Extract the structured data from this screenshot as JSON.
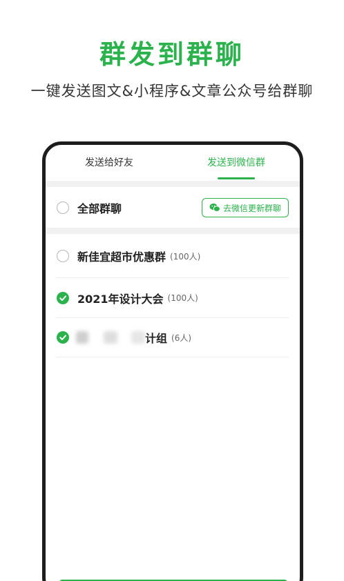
{
  "headline": "群发到群聊",
  "subline": "一键发送图文&小程序&文章公众号给群聊",
  "tabs": [
    {
      "label": "发送给好友",
      "active": false
    },
    {
      "label": "发送到微信群",
      "active": true
    }
  ],
  "select_all": {
    "label": "全部群聊",
    "checked": false
  },
  "update_button": {
    "label": "去微信更新群聊",
    "icon": "wechat-icon"
  },
  "groups": [
    {
      "name": "新佳宜超市优惠群",
      "count": "(100人)",
      "checked": false
    },
    {
      "name": "2021年设计大会",
      "count": "(100人)",
      "checked": true
    },
    {
      "name": "计组",
      "count": "(6人)",
      "checked": true
    }
  ],
  "colors": {
    "accent": "#2bb24c",
    "text": "#222222",
    "divider": "#f1f1f1"
  }
}
